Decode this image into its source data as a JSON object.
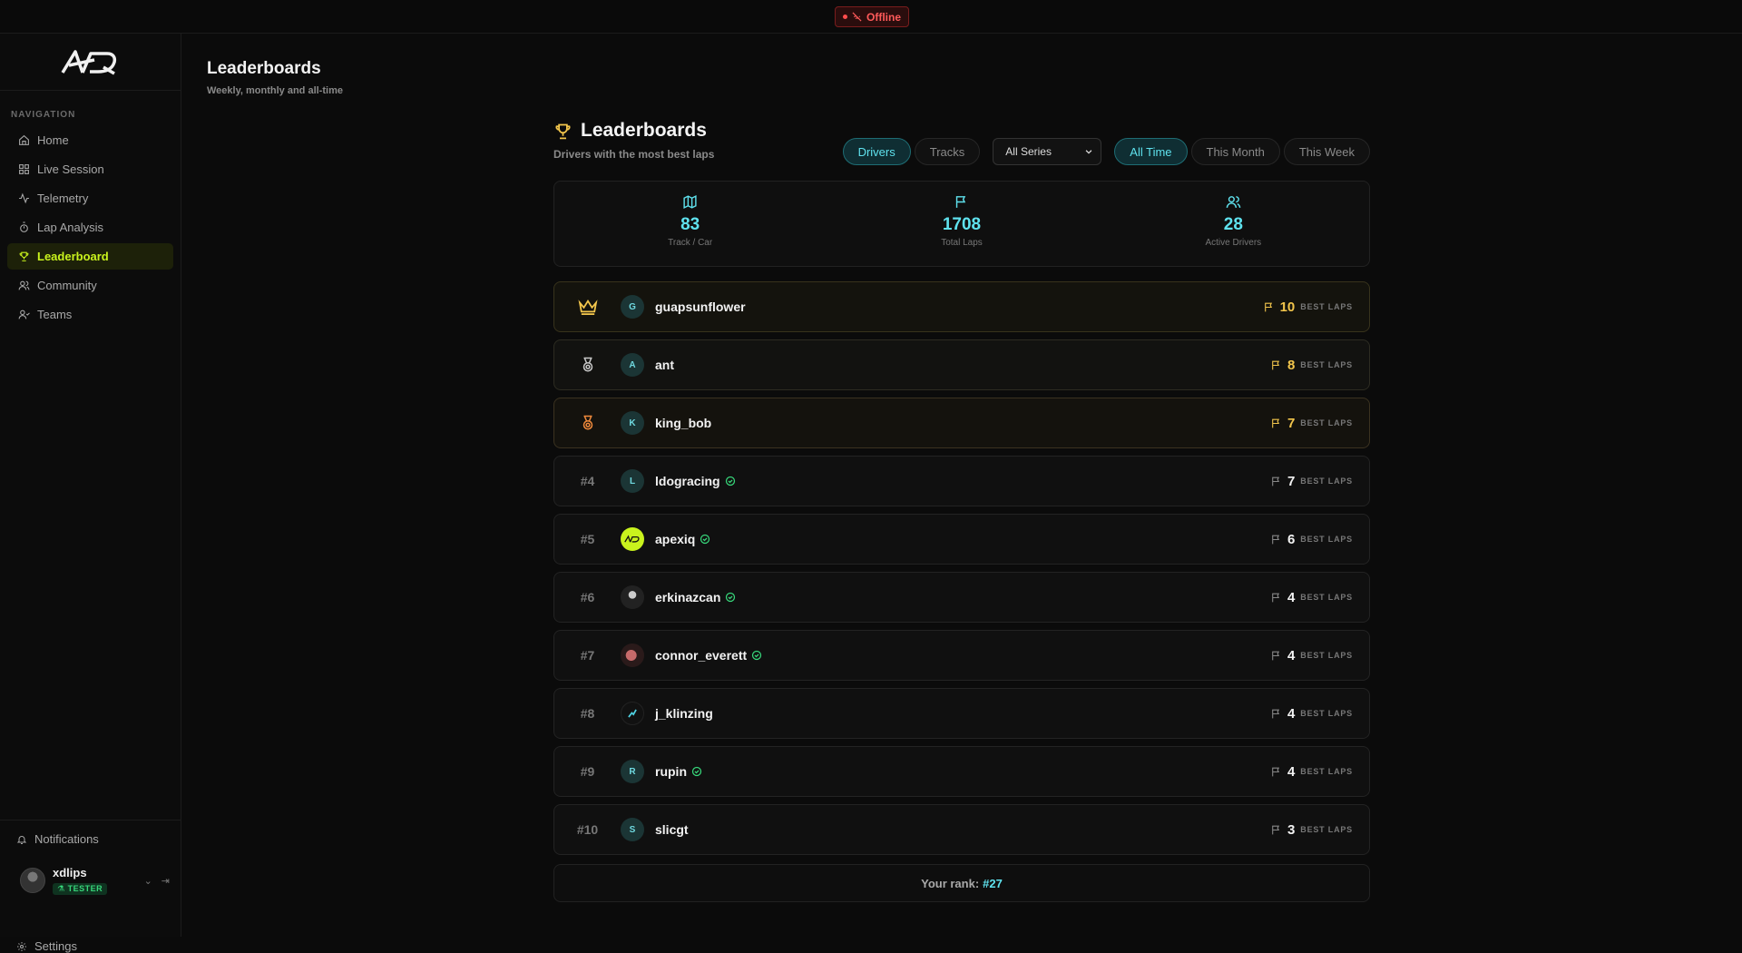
{
  "status": {
    "label": "Offline"
  },
  "sidebar": {
    "nav_title": "NAVIGATION",
    "items": [
      {
        "label": "Home",
        "icon": "home-icon"
      },
      {
        "label": "Live Session",
        "icon": "grid-icon"
      },
      {
        "label": "Telemetry",
        "icon": "activity-icon"
      },
      {
        "label": "Lap Analysis",
        "icon": "stopwatch-icon"
      },
      {
        "label": "Leaderboard",
        "icon": "trophy-icon",
        "active": true
      },
      {
        "label": "Community",
        "icon": "users-icon"
      },
      {
        "label": "Teams",
        "icon": "team-icon"
      }
    ],
    "notifications": "Notifications",
    "user": {
      "name": "xdlips",
      "badge": "TESTER"
    },
    "settings": "Settings"
  },
  "header": {
    "title": "Leaderboards",
    "subtitle": "Weekly, monthly and all-time"
  },
  "panel": {
    "title": "Leaderboards",
    "subtitle": "Drivers with the most best laps",
    "tabs": [
      "Drivers",
      "Tracks"
    ],
    "series_select": "All Series",
    "periods": [
      "All Time",
      "This Month",
      "This Week"
    ],
    "stats": [
      {
        "value": "83",
        "label": "Track / Car"
      },
      {
        "value": "1708",
        "label": "Total Laps"
      },
      {
        "value": "28",
        "label": "Active Drivers"
      }
    ],
    "laps_label": "BEST LAPS",
    "rows": [
      {
        "rank": "",
        "initial": "G",
        "name": "guapsunflower",
        "laps": "10",
        "verified": false
      },
      {
        "rank": "",
        "initial": "A",
        "name": "ant",
        "laps": "8",
        "verified": false
      },
      {
        "rank": "",
        "initial": "K",
        "name": "king_bob",
        "laps": "7",
        "verified": false
      },
      {
        "rank": "#4",
        "initial": "L",
        "name": "ldogracing",
        "laps": "7",
        "verified": true
      },
      {
        "rank": "#5",
        "initial": "",
        "name": "apexiq",
        "laps": "6",
        "verified": true
      },
      {
        "rank": "#6",
        "initial": "",
        "name": "erkinazcan",
        "laps": "4",
        "verified": true
      },
      {
        "rank": "#7",
        "initial": "",
        "name": "connor_everett",
        "laps": "4",
        "verified": true
      },
      {
        "rank": "#8",
        "initial": "",
        "name": "j_klinzing",
        "laps": "4",
        "verified": false
      },
      {
        "rank": "#9",
        "initial": "R",
        "name": "rupin",
        "laps": "4",
        "verified": true
      },
      {
        "rank": "#10",
        "initial": "S",
        "name": "slicgt",
        "laps": "3",
        "verified": false
      }
    ],
    "your_rank_label": "Your rank:",
    "your_rank": "#27"
  },
  "colors": {
    "accent": "#5fe2ee",
    "active_nav": "#c9f31d",
    "gold": "#f3c64c",
    "offline": "#ff5a5a"
  }
}
